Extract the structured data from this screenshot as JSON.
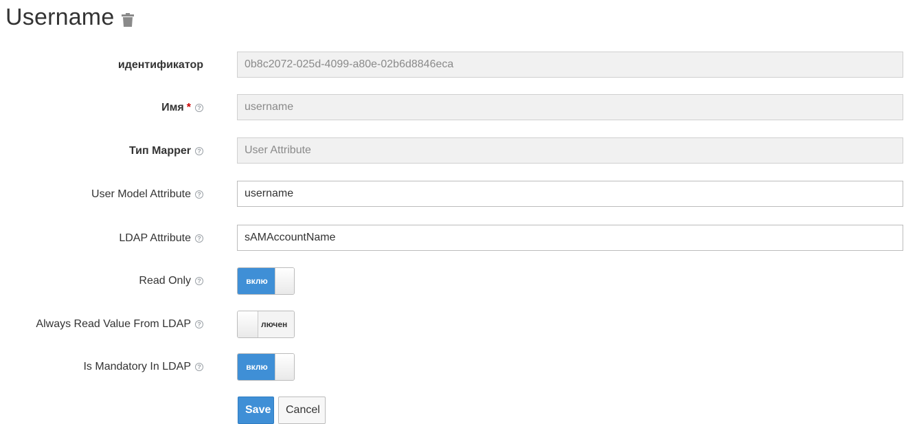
{
  "page": {
    "title": "Username",
    "trash_icon": "trash-icon"
  },
  "form": {
    "id": {
      "label": "идентификатор",
      "value": "0b8c2072-025d-4099-a80e-02b6d8846eca"
    },
    "name": {
      "label": "Имя",
      "required_mark": "*",
      "value": "username"
    },
    "mapper_type": {
      "label": "Тип Mapper",
      "value": "User Attribute"
    },
    "user_model_attribute": {
      "label": "User Model Attribute",
      "value": "username"
    },
    "ldap_attribute": {
      "label": "LDAP Attribute",
      "value": "sAMAccountName"
    },
    "read_only": {
      "label": "Read Only",
      "on": true,
      "on_text": "вклю"
    },
    "always_read_from_ldap": {
      "label": "Always Read Value From LDAP",
      "on": false,
      "off_text": "лючен"
    },
    "is_mandatory_in_ldap": {
      "label": "Is Mandatory In LDAP",
      "on": true,
      "on_text": "вклю"
    },
    "help_icon": "help-circle-icon"
  },
  "actions": {
    "save_label": "Save",
    "cancel_label": "Cancel"
  },
  "colors": {
    "primary": "#3f8fd6",
    "required": "#cc0000",
    "readonly_bg": "#f1f1f1"
  }
}
